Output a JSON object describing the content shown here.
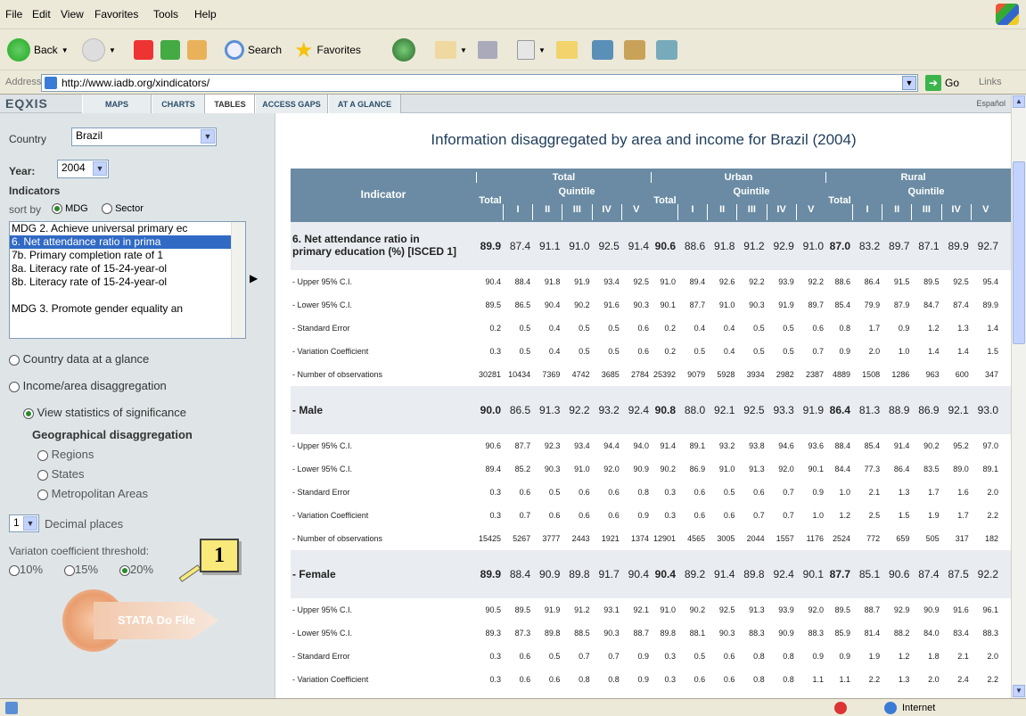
{
  "menu": [
    "File",
    "Edit",
    "View",
    "Favorites",
    "Tools",
    "Help"
  ],
  "toolbar": {
    "back": "Back",
    "search": "Search",
    "favorites": "Favorites"
  },
  "address": {
    "label": "Address",
    "url": "http://www.iadb.org/xindicators/",
    "go": "Go",
    "links": "Links"
  },
  "nav": {
    "logo": "EQXIS",
    "tabs": [
      "MAPS",
      "CHARTS",
      "TABLES",
      "ACCESS GAPS",
      "AT A GLANCE"
    ],
    "active": "TABLES",
    "lang": "Español"
  },
  "sidebar": {
    "country_label": "Country",
    "country": "Brazil",
    "year_label": "Year:",
    "year": "2004",
    "indicators_label": "Indicators",
    "sortby_label": "sort by",
    "sort_mdg": "MDG",
    "sort_sector": "Sector",
    "list": [
      "MDG 2. Achieve universal primary ec",
      "6.     Net attendance ratio in prima",
      "7b.   Primary completion rate of 1",
      "8a.   Literacy rate of 15-24-year-ol",
      "8b.   Literacy rate of 15-24-year-ol",
      "",
      "MDG 3. Promote gender equality an"
    ],
    "opt_country": "Country data at a glance",
    "opt_income": "Income/area disaggregation",
    "opt_stats": "View statistics of significance",
    "geo_label": "Geographical disaggregation",
    "geo": [
      "Regions",
      "States",
      "Metropolitan Areas"
    ],
    "decimals": "1",
    "decimals_label": "Decimal places",
    "threshold_label": "Variaton coefficient threshold:",
    "thresholds": [
      "10%",
      "15%",
      "20%"
    ],
    "stata": "STATA Do File",
    "callout": "1"
  },
  "main": {
    "title": "Information disaggregated by area and income for  Brazil (2004)",
    "indicator_header": "Indicator",
    "groups": [
      "Total",
      "Urban",
      "Rural"
    ],
    "quintile": "Quintile",
    "total": "Total",
    "qcols": [
      "I",
      "II",
      "III",
      "IV",
      "V"
    ],
    "rows": [
      {
        "type": "strong",
        "label": "6. Net attendance ratio in",
        "label2": "primary education (%) [ISCED 1]",
        "v": [
          "89.9",
          "87.4",
          "91.1",
          "91.0",
          "92.5",
          "91.4",
          "90.6",
          "88.6",
          "91.8",
          "91.2",
          "92.9",
          "91.0",
          "87.0",
          "83.2",
          "89.7",
          "87.1",
          "89.9",
          "92.7"
        ]
      },
      {
        "type": "data",
        "label": "- Upper 95% C.I.",
        "v": [
          "90.4",
          "88.4",
          "91.8",
          "91.9",
          "93.4",
          "92.5",
          "91.0",
          "89.4",
          "92.6",
          "92.2",
          "93.9",
          "92.2",
          "88.6",
          "86.4",
          "91.5",
          "89.5",
          "92.5",
          "95.4"
        ]
      },
      {
        "type": "data",
        "label": "- Lower 95% C.I.",
        "v": [
          "89.5",
          "86.5",
          "90.4",
          "90.2",
          "91.6",
          "90.3",
          "90.1",
          "87.7",
          "91.0",
          "90.3",
          "91.9",
          "89.7",
          "85.4",
          "79.9",
          "87.9",
          "84.7",
          "87.4",
          "89.9"
        ]
      },
      {
        "type": "data",
        "label": "- Standard Error",
        "v": [
          "0.2",
          "0.5",
          "0.4",
          "0.5",
          "0.5",
          "0.6",
          "0.2",
          "0.4",
          "0.4",
          "0.5",
          "0.5",
          "0.6",
          "0.8",
          "1.7",
          "0.9",
          "1.2",
          "1.3",
          "1.4"
        ]
      },
      {
        "type": "data",
        "label": "- Variation Coefficient",
        "v": [
          "0.3",
          "0.5",
          "0.4",
          "0.5",
          "0.5",
          "0.6",
          "0.2",
          "0.5",
          "0.4",
          "0.5",
          "0.5",
          "0.7",
          "0.9",
          "2.0",
          "1.0",
          "1.4",
          "1.4",
          "1.5"
        ]
      },
      {
        "type": "data",
        "label": "- Number of observations",
        "v": [
          "30281",
          "10434",
          "7369",
          "4742",
          "3685",
          "2784",
          "25392",
          "9079",
          "5928",
          "3934",
          "2982",
          "2387",
          "4889",
          "1508",
          "1286",
          "963",
          "600",
          "347"
        ]
      },
      {
        "type": "strong",
        "label": "- Male",
        "v": [
          "90.0",
          "86.5",
          "91.3",
          "92.2",
          "93.2",
          "92.4",
          "90.8",
          "88.0",
          "92.1",
          "92.5",
          "93.3",
          "91.9",
          "86.4",
          "81.3",
          "88.9",
          "86.9",
          "92.1",
          "93.0"
        ]
      },
      {
        "type": "data",
        "label": "- Upper 95% C.I.",
        "v": [
          "90.6",
          "87.7",
          "92.3",
          "93.4",
          "94.4",
          "94.0",
          "91.4",
          "89.1",
          "93.2",
          "93.8",
          "94.6",
          "93.6",
          "88.4",
          "85.4",
          "91.4",
          "90.2",
          "95.2",
          "97.0"
        ]
      },
      {
        "type": "data",
        "label": "- Lower 95% C.I.",
        "v": [
          "89.4",
          "85.2",
          "90.3",
          "91.0",
          "92.0",
          "90.9",
          "90.2",
          "86.9",
          "91.0",
          "91.3",
          "92.0",
          "90.1",
          "84.4",
          "77.3",
          "86.4",
          "83.5",
          "89.0",
          "89.1"
        ]
      },
      {
        "type": "data",
        "label": "- Standard Error",
        "v": [
          "0.3",
          "0.6",
          "0.5",
          "0.6",
          "0.6",
          "0.8",
          "0.3",
          "0.6",
          "0.5",
          "0.6",
          "0.7",
          "0.9",
          "1.0",
          "2.1",
          "1.3",
          "1.7",
          "1.6",
          "2.0"
        ]
      },
      {
        "type": "data",
        "label": "- Variation Coefficient",
        "v": [
          "0.3",
          "0.7",
          "0.6",
          "0.6",
          "0.6",
          "0.9",
          "0.3",
          "0.6",
          "0.6",
          "0.7",
          "0.7",
          "1.0",
          "1.2",
          "2.5",
          "1.5",
          "1.9",
          "1.7",
          "2.2"
        ]
      },
      {
        "type": "data",
        "label": "- Number of observations",
        "v": [
          "15425",
          "5267",
          "3777",
          "2443",
          "1921",
          "1374",
          "12901",
          "4565",
          "3005",
          "2044",
          "1557",
          "1176",
          "2524",
          "772",
          "659",
          "505",
          "317",
          "182"
        ]
      },
      {
        "type": "strong",
        "label": "- Female",
        "v": [
          "89.9",
          "88.4",
          "90.9",
          "89.8",
          "91.7",
          "90.4",
          "90.4",
          "89.2",
          "91.4",
          "89.8",
          "92.4",
          "90.1",
          "87.7",
          "85.1",
          "90.6",
          "87.4",
          "87.5",
          "92.2"
        ]
      },
      {
        "type": "data",
        "label": "- Upper 95% C.I.",
        "v": [
          "90.5",
          "89.5",
          "91.9",
          "91.2",
          "93.1",
          "92.1",
          "91.0",
          "90.2",
          "92.5",
          "91.3",
          "93.9",
          "92.0",
          "89.5",
          "88.7",
          "92.9",
          "90.9",
          "91.6",
          "96.1"
        ]
      },
      {
        "type": "data",
        "label": "- Lower 95% C.I.",
        "v": [
          "89.3",
          "87.3",
          "89.8",
          "88.5",
          "90.3",
          "88.7",
          "89.8",
          "88.1",
          "90.3",
          "88.3",
          "90.9",
          "88.3",
          "85.9",
          "81.4",
          "88.2",
          "84.0",
          "83.4",
          "88.3"
        ]
      },
      {
        "type": "data",
        "label": "- Standard Error",
        "v": [
          "0.3",
          "0.6",
          "0.5",
          "0.7",
          "0.7",
          "0.9",
          "0.3",
          "0.5",
          "0.6",
          "0.8",
          "0.8",
          "0.9",
          "0.9",
          "1.9",
          "1.2",
          "1.8",
          "2.1",
          "2.0"
        ]
      },
      {
        "type": "data",
        "label": "- Variation Coefficient",
        "v": [
          "0.3",
          "0.6",
          "0.6",
          "0.8",
          "0.8",
          "0.9",
          "0.3",
          "0.6",
          "0.6",
          "0.8",
          "0.8",
          "1.1",
          "1.1",
          "2.2",
          "1.3",
          "2.0",
          "2.4",
          "2.2"
        ]
      }
    ]
  },
  "status": {
    "zone": "Internet"
  },
  "colors": {
    "header": "#6a8ba3",
    "highlight": "#316ac5",
    "panel": "#dfe5e7"
  }
}
